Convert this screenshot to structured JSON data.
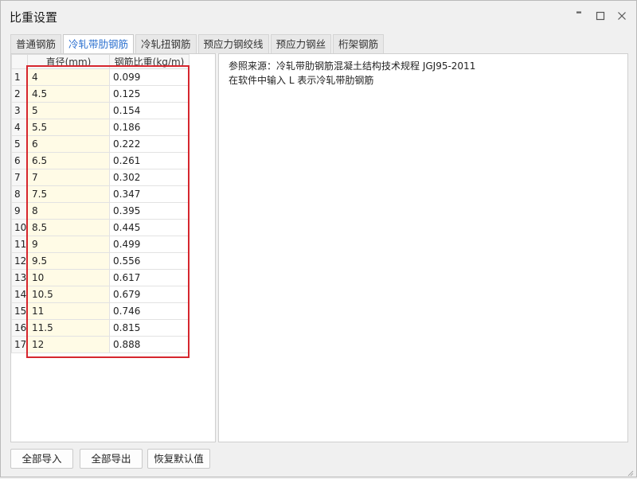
{
  "window": {
    "title": "比重设置"
  },
  "tabs": [
    {
      "label": "普通钢筋",
      "active": false
    },
    {
      "label": "冷轧带肋钢筋",
      "active": true
    },
    {
      "label": "冷轧扭钢筋",
      "active": false
    },
    {
      "label": "预应力钢绞线",
      "active": false
    },
    {
      "label": "预应力钢丝",
      "active": false
    },
    {
      "label": "桁架钢筋",
      "active": false
    }
  ],
  "table": {
    "columns": [
      "直径(mm)",
      "钢筋比重(kg/m)"
    ],
    "rows": [
      {
        "n": "1",
        "diameter": "4",
        "weight": "0.099"
      },
      {
        "n": "2",
        "diameter": "4.5",
        "weight": "0.125"
      },
      {
        "n": "3",
        "diameter": "5",
        "weight": "0.154"
      },
      {
        "n": "4",
        "diameter": "5.5",
        "weight": "0.186"
      },
      {
        "n": "5",
        "diameter": "6",
        "weight": "0.222"
      },
      {
        "n": "6",
        "diameter": "6.5",
        "weight": "0.261"
      },
      {
        "n": "7",
        "diameter": "7",
        "weight": "0.302"
      },
      {
        "n": "8",
        "diameter": "7.5",
        "weight": "0.347"
      },
      {
        "n": "9",
        "diameter": "8",
        "weight": "0.395"
      },
      {
        "n": "10",
        "diameter": "8.5",
        "weight": "0.445"
      },
      {
        "n": "11",
        "diameter": "9",
        "weight": "0.499"
      },
      {
        "n": "12",
        "diameter": "9.5",
        "weight": "0.556"
      },
      {
        "n": "13",
        "diameter": "10",
        "weight": "0.617"
      },
      {
        "n": "14",
        "diameter": "10.5",
        "weight": "0.679"
      },
      {
        "n": "15",
        "diameter": "11",
        "weight": "0.746"
      },
      {
        "n": "16",
        "diameter": "11.5",
        "weight": "0.815"
      },
      {
        "n": "17",
        "diameter": "12",
        "weight": "0.888"
      }
    ]
  },
  "info": {
    "line1": "参照来源：冷轧带肋钢筋混凝土结构技术规程 JGJ95-2011",
    "line2": "在软件中输入 L 表示冷轧带肋钢筋"
  },
  "buttons": {
    "import_all": "全部导入",
    "export_all": "全部导出",
    "restore_default": "恢复默认值"
  },
  "colors": {
    "highlight_border": "#d6262e",
    "active_tab_text": "#2a6fcf",
    "diameter_cell_bg": "#fffbe6"
  },
  "icons": {
    "help": "help-icon",
    "minimize": "minimize-icon",
    "maximize": "maximize-icon",
    "close": "close-icon"
  }
}
